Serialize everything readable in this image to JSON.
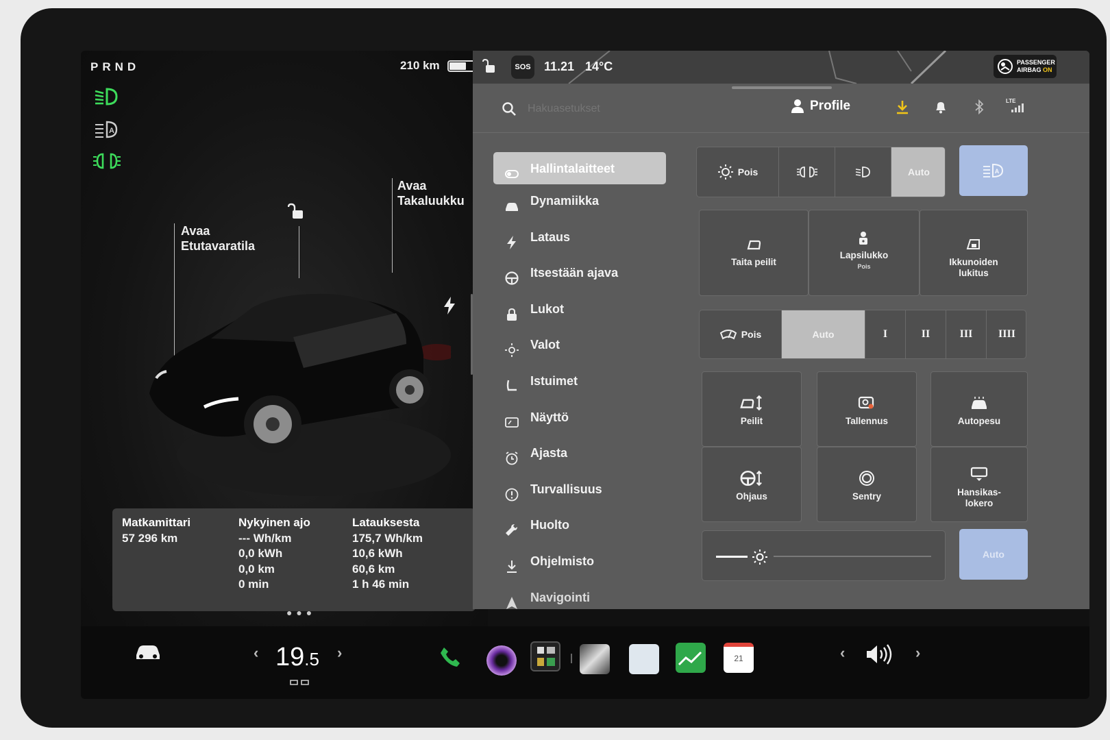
{
  "status": {
    "gear": "PRND",
    "range": "210 km",
    "battery_level": 0.68,
    "time": "11.21",
    "temperature": "14°C",
    "sos_label": "SOS",
    "airbag_line1": "PASSENGER",
    "airbag_line2": "AIRBAG",
    "airbag_state": "ON"
  },
  "car_view": {
    "frunk_label": "Avaa\nEtutavaratila",
    "trunk_label": "Avaa\nTakaluukku"
  },
  "trip_stats": {
    "odometer": {
      "title": "Matkamittari",
      "lines": [
        "57 296 km"
      ]
    },
    "current_drive": {
      "title": "Nykyinen ajo",
      "lines": [
        "--- Wh/km",
        "0,0 kWh",
        "0,0 km",
        "0 min"
      ]
    },
    "since_charge": {
      "title": "Latauksesta",
      "lines": [
        "175,7 Wh/km",
        "10,6 kWh",
        "60,6 km",
        "1 h 46 min"
      ]
    }
  },
  "search": {
    "placeholder": "Hakuasetukset"
  },
  "header": {
    "profile_label": "Profile",
    "network_label": "LTE"
  },
  "menu": [
    {
      "label": "Hallintalaitteet",
      "icon": "toggle-icon",
      "active": true
    },
    {
      "label": "Dynamiikka",
      "icon": "car-icon"
    },
    {
      "label": "Lataus",
      "icon": "bolt-icon"
    },
    {
      "label": "Itsestään ajava",
      "icon": "steering-wheel-icon"
    },
    {
      "label": "Lukot",
      "icon": "lock-icon"
    },
    {
      "label": "Valot",
      "icon": "sun-icon"
    },
    {
      "label": "Istuimet",
      "icon": "seat-icon"
    },
    {
      "label": "Näyttö",
      "icon": "display-icon"
    },
    {
      "label": "Ajasta",
      "icon": "alarm-clock-icon"
    },
    {
      "label": "Turvallisuus",
      "icon": "info-circle-icon"
    },
    {
      "label": "Huolto",
      "icon": "wrench-icon"
    },
    {
      "label": "Ohjelmisto",
      "icon": "download-icon"
    },
    {
      "label": "Navigointi",
      "icon": "navigation-arrow-icon"
    }
  ],
  "lights": {
    "off_label": "Pois",
    "auto_label": "Auto",
    "selected": "Auto"
  },
  "tiles_row1": [
    {
      "label": "Taita peilit",
      "icon": "mirror-fold-icon"
    },
    {
      "label": "Lapsilukko",
      "sub": "Pois",
      "icon": "child-lock-icon"
    },
    {
      "label": "Ikkunoiden\nlukitus",
      "icon": "window-lock-icon"
    }
  ],
  "wipers": {
    "off_label": "Pois",
    "auto_label": "Auto",
    "speeds": [
      "I",
      "II",
      "III",
      "IIII"
    ],
    "selected": "Auto"
  },
  "tiles_grid": [
    {
      "label": "Peilit",
      "icon": "mirror-adjust-icon"
    },
    {
      "label": "Tallennus",
      "icon": "dashcam-icon"
    },
    {
      "label": "Autopesu",
      "icon": "car-wash-icon"
    },
    {
      "label": "Ohjaus",
      "icon": "steering-adjust-icon"
    },
    {
      "label": "Sentry",
      "icon": "sentry-icon"
    },
    {
      "label": "Hansikas-\nlokero",
      "icon": "glovebox-icon"
    }
  ],
  "brightness": {
    "auto_label": "Auto"
  },
  "dock": {
    "temperature": "19",
    "temperature_decimal": ".5",
    "calendar_day": "21"
  },
  "colors": {
    "headlight_green": "#3ddc5b",
    "blue_button": "#a9bde3",
    "settings_bg": "#5b5b5b"
  }
}
